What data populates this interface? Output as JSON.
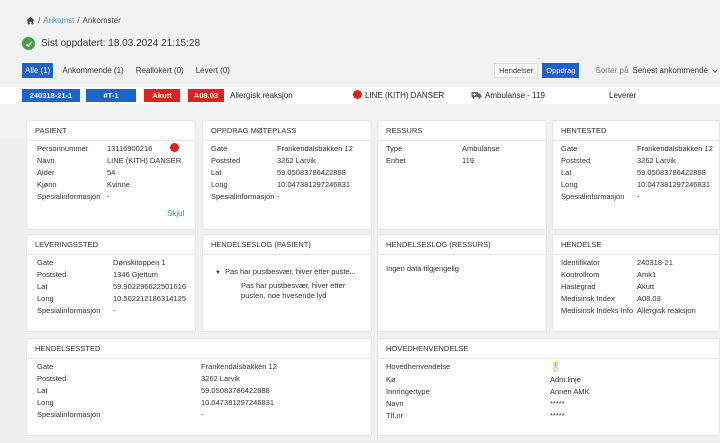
{
  "breadcrumb": {
    "link": "Ankomst",
    "sep": "/",
    "current": "Ankomster"
  },
  "status": {
    "updated": "Sist oppdatert: 18.03.2024 21:15:28"
  },
  "tabs": [
    {
      "label": "Alle (1)",
      "active": true
    },
    {
      "label": "Ankommende (1)",
      "active": false
    },
    {
      "label": "Reallokert (0)",
      "active": false
    },
    {
      "label": "Levert (0)",
      "active": false
    }
  ],
  "toolbar": {
    "hendelser": "Hendelser",
    "oppdrag": "Oppdrag",
    "sort_label": "Sorter på",
    "sort_value": "Senest ankommende"
  },
  "assignment": {
    "id": "240318-21-1",
    "tag": "#T-1",
    "priority": "Akutt",
    "index_code": "A08.03",
    "index_text": "Allergisk reaksjon",
    "patient_name": "LINE (KITH) DANSER",
    "resource": "Ambulanse - 119",
    "status": "Leverer"
  },
  "pasient": {
    "title": "PASIENT",
    "rows": [
      {
        "k": "Personnummer",
        "v": "13116900216"
      },
      {
        "k": "Navn",
        "v": "LINE (KITH) DANSER"
      },
      {
        "k": "Alder",
        "v": "54"
      },
      {
        "k": "Kjønn",
        "v": "Kvinne"
      },
      {
        "k": "Spesialinformasjon",
        "v": "-"
      }
    ],
    "hide": "Skjul"
  },
  "moteplass": {
    "title": "OPPDRAG MØTEPLASS",
    "rows": [
      {
        "k": "Gate",
        "v": "Frankendalsbakken 12"
      },
      {
        "k": "Poststed",
        "v": "3262 Larvik"
      },
      {
        "k": "Lat",
        "v": "59.05083786422888"
      },
      {
        "k": "Long",
        "v": "10.047381297246831"
      },
      {
        "k": "Spesialinformasjon",
        "v": "-"
      }
    ]
  },
  "ressurs": {
    "title": "RESSURS",
    "rows": [
      {
        "k": "Type",
        "v": "Ambulanse"
      },
      {
        "k": "Enhet",
        "v": "119"
      }
    ]
  },
  "hentested": {
    "title": "HENTESTED",
    "rows": [
      {
        "k": "Gate",
        "v": "Frankendalsbakken 12"
      },
      {
        "k": "Poststed",
        "v": "3262 Larvik"
      },
      {
        "k": "Lat",
        "v": "59.05083786422888"
      },
      {
        "k": "Long",
        "v": "10.047381297246831"
      },
      {
        "k": "Spesialinformasjon",
        "v": "-"
      }
    ]
  },
  "leveringssted": {
    "title": "LEVERINGSSTED",
    "rows": [
      {
        "k": "Gate",
        "v": "Dønskitoppen 1"
      },
      {
        "k": "Poststed",
        "v": "1346 Gjettum"
      },
      {
        "k": "Lat",
        "v": "59.90229662250​1616"
      },
      {
        "k": "Long",
        "v": "10.502212186314125"
      },
      {
        "k": "Spesialinformasjon",
        "v": "-"
      }
    ]
  },
  "logg_pasient": {
    "title": "HENDELSESLOG (PASIENT)",
    "item_head": "Pas har pustbesvær, hiver etter puste...",
    "item_body": "Pas har pustbesvær, hiver etter pusten, noe hvesende lyd"
  },
  "logg_ressurs": {
    "title": "HENDELSESLOG (RESSURS)",
    "empty": "Ingen data tilgjengelig"
  },
  "hendelse": {
    "title": "HENDELSE",
    "rows": [
      {
        "k": "Identifikator",
        "v": "240318-21"
      },
      {
        "k": "Kontrollrom",
        "v": "Amk1"
      },
      {
        "k": "Hastegrad",
        "v": "Akutt"
      },
      {
        "k": "Medisinsk Index",
        "v": "A08.03"
      },
      {
        "k": "Medisinsk Indeks Info",
        "v": "Allergisk reaksjon"
      }
    ]
  },
  "hendelsessted": {
    "title": "HENDELSESSTED",
    "rows": [
      {
        "k": "Gate",
        "v": "Frankendalsbakken 12"
      },
      {
        "k": "Poststed",
        "v": "3262 Larvik"
      },
      {
        "k": "Lat",
        "v": "59.05083786422888"
      },
      {
        "k": "Long",
        "v": "10.047381297246831"
      },
      {
        "k": "Spesialinformasjon",
        "v": "-"
      }
    ]
  },
  "hovedhenvendelse": {
    "title": "HOVEDHENVENDELSE",
    "rows": [
      {
        "k": "Hovedhenvendelse",
        "v": ""
      },
      {
        "k": "Kø",
        "v": "Adm.linje"
      },
      {
        "k": "Innringertype",
        "v": "Annen AMK"
      },
      {
        "k": "Navn",
        "v": "*****"
      },
      {
        "k": "Tlf.nr",
        "v": "*****"
      }
    ]
  },
  "colors": {
    "primary": "#1e63c7",
    "danger": "#e41f1f",
    "success": "#45a047",
    "link": "#3d8fd6"
  }
}
